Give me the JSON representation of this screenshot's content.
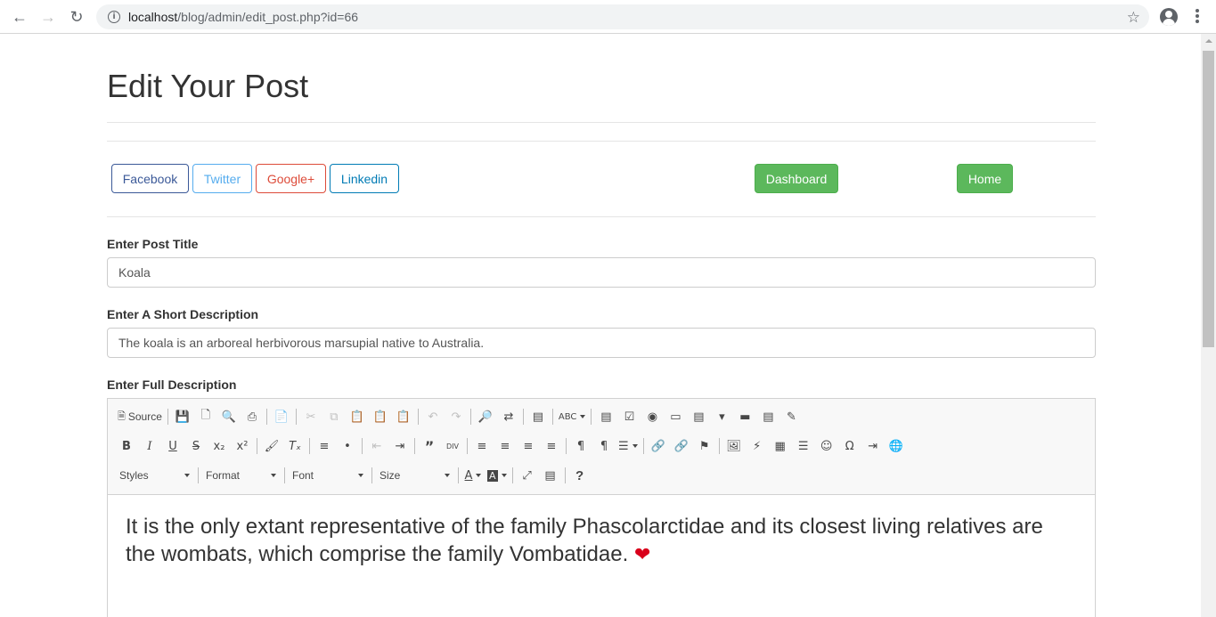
{
  "browser": {
    "url_host": "localhost",
    "url_path": "/blog/admin/edit_post.php?id=66",
    "back_icon": "arrow-left-icon",
    "forward_icon": "arrow-right-icon",
    "reload_icon": "reload-icon",
    "info_icon": "info-icon",
    "star_icon": "star-icon",
    "profile_icon": "profile-icon",
    "menu_icon": "kebab-menu-icon"
  },
  "page": {
    "title": "Edit Your Post"
  },
  "social": {
    "facebook": "Facebook",
    "twitter": "Twitter",
    "google": "Google+",
    "linkedin": "Linkedin",
    "colors": {
      "facebook": "#3b5998",
      "twitter": "#55acee",
      "google": "#dd4b39",
      "linkedin": "#007bb5"
    }
  },
  "nav": {
    "dashboard": "Dashboard",
    "home": "Home",
    "color": "#5cb85c"
  },
  "form": {
    "title_label": "Enter Post Title",
    "title_value": "Koala",
    "short_label": "Enter A Short Description",
    "short_value": "The koala is an arboreal herbivorous marsupial native to Australia.",
    "full_label": "Enter Full Description"
  },
  "editor": {
    "source_label": "Source",
    "styles": "Styles",
    "format": "Format",
    "font": "Font",
    "size": "Size",
    "content": "It is the only extant representative of the family Phascolarctidae and its closest living relatives are the wombats, which comprise the family Vombatidae.",
    "emoji": "❤"
  }
}
